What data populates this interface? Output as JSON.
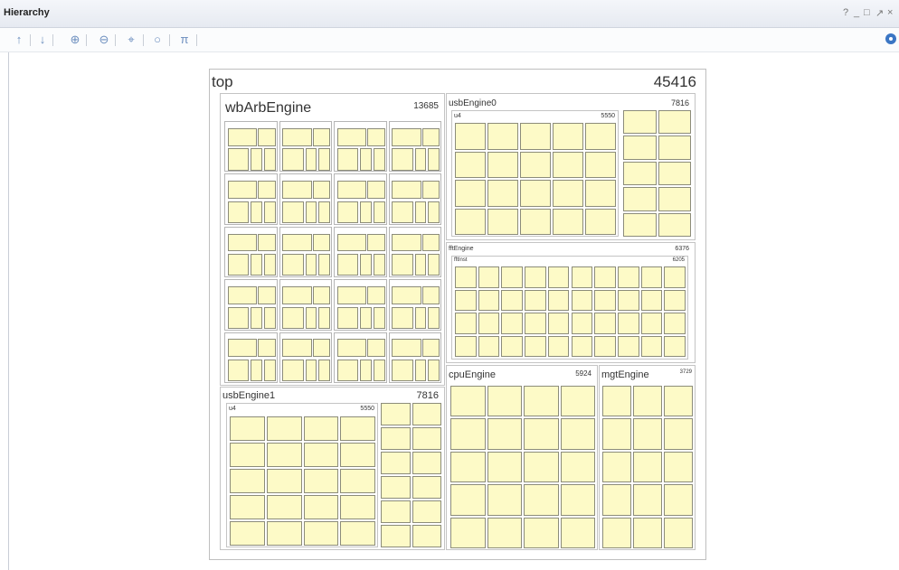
{
  "window": {
    "title": "Hierarchy",
    "controls": [
      "?",
      "_",
      "□",
      "↗",
      "×"
    ]
  },
  "toolbar": {
    "icons": [
      "arrow-up-icon",
      "arrow-down-icon",
      "zoom-in-icon",
      "zoom-out-icon",
      "fit-icon",
      "circle-icon",
      "pi-icon"
    ],
    "glyphs": [
      "↑",
      "↓",
      "⊕",
      "⊖",
      "⌖",
      "○",
      "π"
    ],
    "settings_icon": "gear-icon"
  },
  "treemap": {
    "root": {
      "name": "top",
      "value": "45416"
    },
    "wbArbEngine": {
      "name": "wbArbEngine",
      "value": "13685"
    },
    "usbEngine0": {
      "name": "usbEngine0",
      "value": "7816",
      "child": {
        "name": "u4",
        "value": "5550"
      }
    },
    "fftEngine": {
      "name": "fftEngine",
      "value": "6376",
      "child": {
        "name": "fftInst",
        "value": "6205"
      }
    },
    "cpuEngine": {
      "name": "cpuEngine",
      "value": "5924"
    },
    "mgtEngine": {
      "name": "mgtEngine",
      "value": "3729"
    },
    "usbEngine1": {
      "name": "usbEngine1",
      "value": "7816",
      "child": {
        "name": "u4",
        "value": "5550"
      }
    },
    "leaf_color": "#fdfac7"
  }
}
